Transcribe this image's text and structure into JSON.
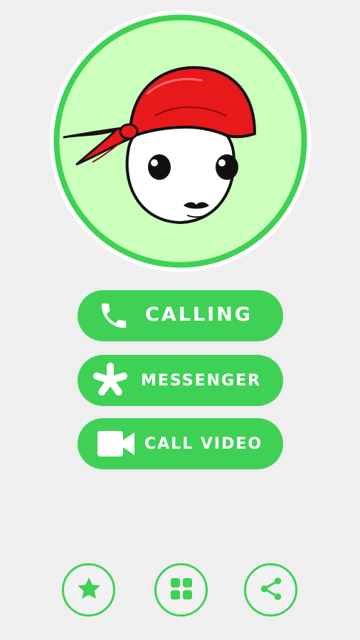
{
  "colors": {
    "background": "#efefef",
    "accent_green": "#3fd155",
    "avatar_fill": "#ccffbb",
    "bandana_red": "#e8191a",
    "white": "#ffffff"
  },
  "buttons": {
    "calling": {
      "label": "CALLING",
      "icon": "phone-icon"
    },
    "messenger": {
      "label": "MESSENGER",
      "icon": "asterisk-icon"
    },
    "call_video": {
      "label": "CALL VIDEO",
      "icon": "video-camera-icon"
    }
  },
  "bottom_bar": {
    "rate": {
      "icon": "star-icon"
    },
    "more_apps": {
      "icon": "grid-icon"
    },
    "share": {
      "icon": "share-icon"
    }
  }
}
